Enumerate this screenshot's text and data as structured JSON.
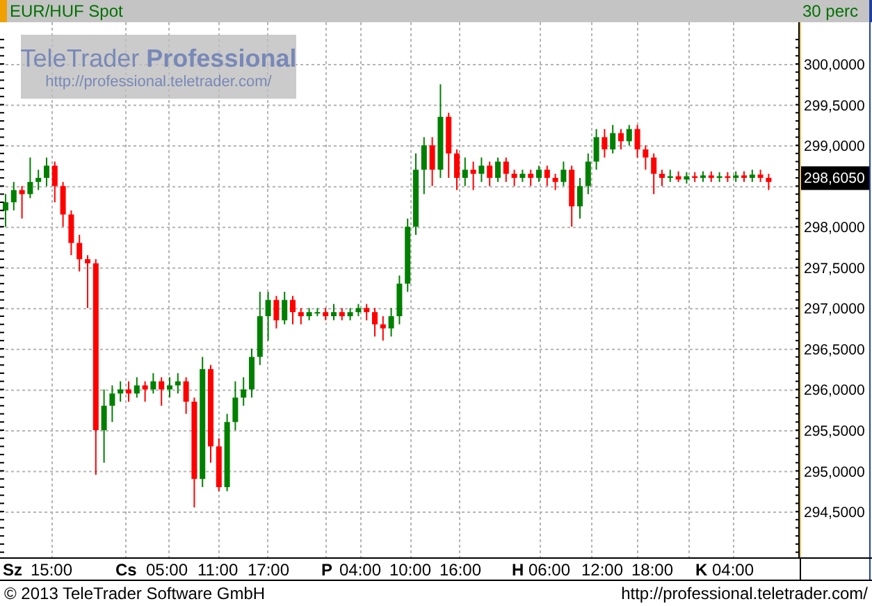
{
  "header": {
    "title": "EUR/HUF Spot",
    "interval": "30 perc"
  },
  "watermark": {
    "brand": "TeleTrader **Professional**",
    "url": "http://professional.teletrader.com/"
  },
  "chart": {
    "kind": "picture",
    "last_price": "298,6050",
    "price_labels": [
      "300,0000",
      "299,5000",
      "299,0000",
      "298,0000",
      "297,5000",
      "297,0000",
      "296,5000",
      "296,0000",
      "295,5000",
      "295,0000",
      "294,5000"
    ],
    "time_labels": [
      {
        "kind": "day",
        "text": "Sz"
      },
      {
        "kind": "time",
        "text": "15:00"
      },
      {
        "kind": "day",
        "text": "Cs"
      },
      {
        "kind": "time",
        "text": "05:00"
      },
      {
        "kind": "time",
        "text": "11:00"
      },
      {
        "kind": "time",
        "text": "17:00"
      },
      {
        "kind": "day",
        "text": "P"
      },
      {
        "kind": "time",
        "text": "04:00"
      },
      {
        "kind": "time",
        "text": "10:00"
      },
      {
        "kind": "time",
        "text": "16:00"
      },
      {
        "kind": "day",
        "text": "H"
      },
      {
        "kind": "time",
        "text": "06:00"
      },
      {
        "kind": "time",
        "text": "12:00"
      },
      {
        "kind": "time",
        "text": "18:00"
      },
      {
        "kind": "day",
        "text": "K"
      },
      {
        "kind": "time",
        "text": "04:00"
      }
    ]
  },
  "footer": {
    "copyright": "© 2013 TeleTrader Software GmbH",
    "url": "http://professional.teletrader.com/"
  }
}
